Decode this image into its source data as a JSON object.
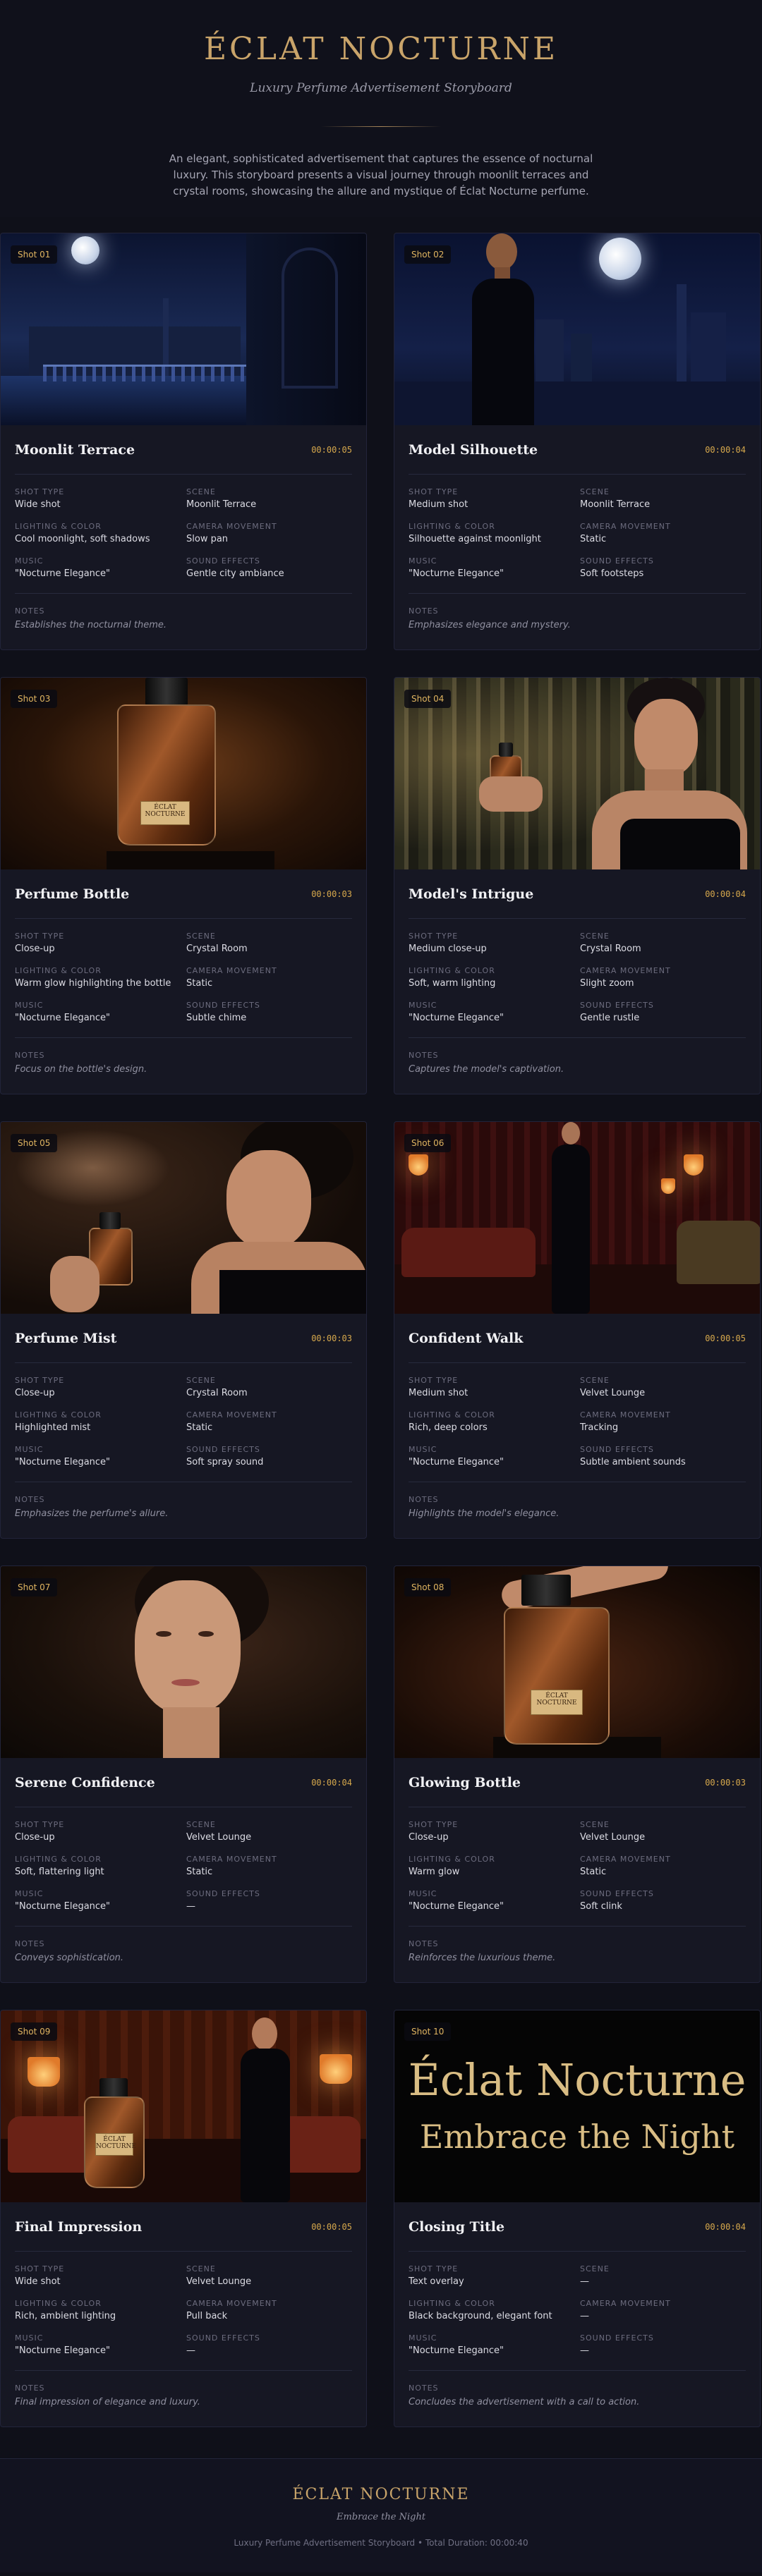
{
  "header": {
    "title": "ÉCLAT NOCTURNE",
    "subtitle": "Luxury Perfume Advertisement Storyboard",
    "intro": "An elegant, sophisticated advertisement that captures the essence of nocturnal luxury. This storyboard presents a visual journey through moonlit terraces and crystal rooms, showcasing the allure and mystique of Éclat Nocturne perfume."
  },
  "labels": {
    "shot_type": "SHOT TYPE",
    "scene": "SCENE",
    "lighting": "LIGHTING & COLOR",
    "camera": "CAMERA MOVEMENT",
    "music": "MUSIC",
    "sound": "SOUND EFFECTS",
    "notes": "NOTES"
  },
  "shots": [
    {
      "badge": "Shot 01",
      "title": "Moonlit Terrace",
      "duration": "00:00:05",
      "shot_type": "Wide shot",
      "scene": "Moonlit Terrace",
      "lighting": "Cool moonlight, soft shadows",
      "camera": "Slow pan",
      "music": "\"Nocturne Elegance\"",
      "sound": "Gentle city ambiance",
      "notes": "Establishes the nocturnal theme."
    },
    {
      "badge": "Shot 02",
      "title": "Model Silhouette",
      "duration": "00:00:04",
      "shot_type": "Medium shot",
      "scene": "Moonlit Terrace",
      "lighting": "Silhouette against moonlight",
      "camera": "Static",
      "music": "\"Nocturne Elegance\"",
      "sound": "Soft footsteps",
      "notes": "Emphasizes elegance and mystery."
    },
    {
      "badge": "Shot 03",
      "title": "Perfume Bottle",
      "duration": "00:00:03",
      "shot_type": "Close-up",
      "scene": "Crystal Room",
      "lighting": "Warm glow highlighting the bottle",
      "camera": "Static",
      "music": "\"Nocturne Elegance\"",
      "sound": "Subtle chime",
      "notes": "Focus on the bottle's design."
    },
    {
      "badge": "Shot 04",
      "title": "Model's Intrigue",
      "duration": "00:00:04",
      "shot_type": "Medium close-up",
      "scene": "Crystal Room",
      "lighting": "Soft, warm lighting",
      "camera": "Slight zoom",
      "music": "\"Nocturne Elegance\"",
      "sound": "Gentle rustle",
      "notes": "Captures the model's captivation."
    },
    {
      "badge": "Shot 05",
      "title": "Perfume Mist",
      "duration": "00:00:03",
      "shot_type": "Close-up",
      "scene": "Crystal Room",
      "lighting": "Highlighted mist",
      "camera": "Static",
      "music": "\"Nocturne Elegance\"",
      "sound": "Soft spray sound",
      "notes": "Emphasizes the perfume's allure."
    },
    {
      "badge": "Shot 06",
      "title": "Confident Walk",
      "duration": "00:00:05",
      "shot_type": "Medium shot",
      "scene": "Velvet Lounge",
      "lighting": "Rich, deep colors",
      "camera": "Tracking",
      "music": "\"Nocturne Elegance\"",
      "sound": "Subtle ambient sounds",
      "notes": "Highlights the model's elegance."
    },
    {
      "badge": "Shot 07",
      "title": "Serene Confidence",
      "duration": "00:00:04",
      "shot_type": "Close-up",
      "scene": "Velvet Lounge",
      "lighting": "Soft, flattering light",
      "camera": "Static",
      "music": "\"Nocturne Elegance\"",
      "sound": "—",
      "notes": "Conveys sophistication."
    },
    {
      "badge": "Shot 08",
      "title": "Glowing Bottle",
      "duration": "00:00:03",
      "shot_type": "Close-up",
      "scene": "Velvet Lounge",
      "lighting": "Warm glow",
      "camera": "Static",
      "music": "\"Nocturne Elegance\"",
      "sound": "Soft clink",
      "notes": "Reinforces the luxurious theme."
    },
    {
      "badge": "Shot 09",
      "title": "Final Impression",
      "duration": "00:00:05",
      "shot_type": "Wide shot",
      "scene": "Velvet Lounge",
      "lighting": "Rich, ambient lighting",
      "camera": "Pull back",
      "music": "\"Nocturne Elegance\"",
      "sound": "—",
      "notes": "Final impression of elegance and luxury."
    },
    {
      "badge": "Shot 10",
      "title": "Closing Title",
      "duration": "00:00:04",
      "shot_type": "Text overlay",
      "scene": "—",
      "lighting": "Black background, elegant font",
      "camera": "—",
      "music": "\"Nocturne Elegance\"",
      "sound": "—",
      "notes": "Concludes the advertisement with a call to action."
    }
  ],
  "closing_art": {
    "line1": "Éclat Nocturne",
    "line2": "Embrace the Night"
  },
  "bottle_label": {
    "line1": "ÉCLAT",
    "line2": "NOCTURNE"
  },
  "footer": {
    "title": "ÉCLAT NOCTURNE",
    "tagline": "Embrace the Night",
    "meta": "Luxury Perfume Advertisement Storyboard • Total Duration: 00:00:40"
  },
  "colors": {
    "accent": "#c9a46a",
    "duration": "#d6a84c",
    "background": "#0f1019",
    "card": "#161723"
  }
}
